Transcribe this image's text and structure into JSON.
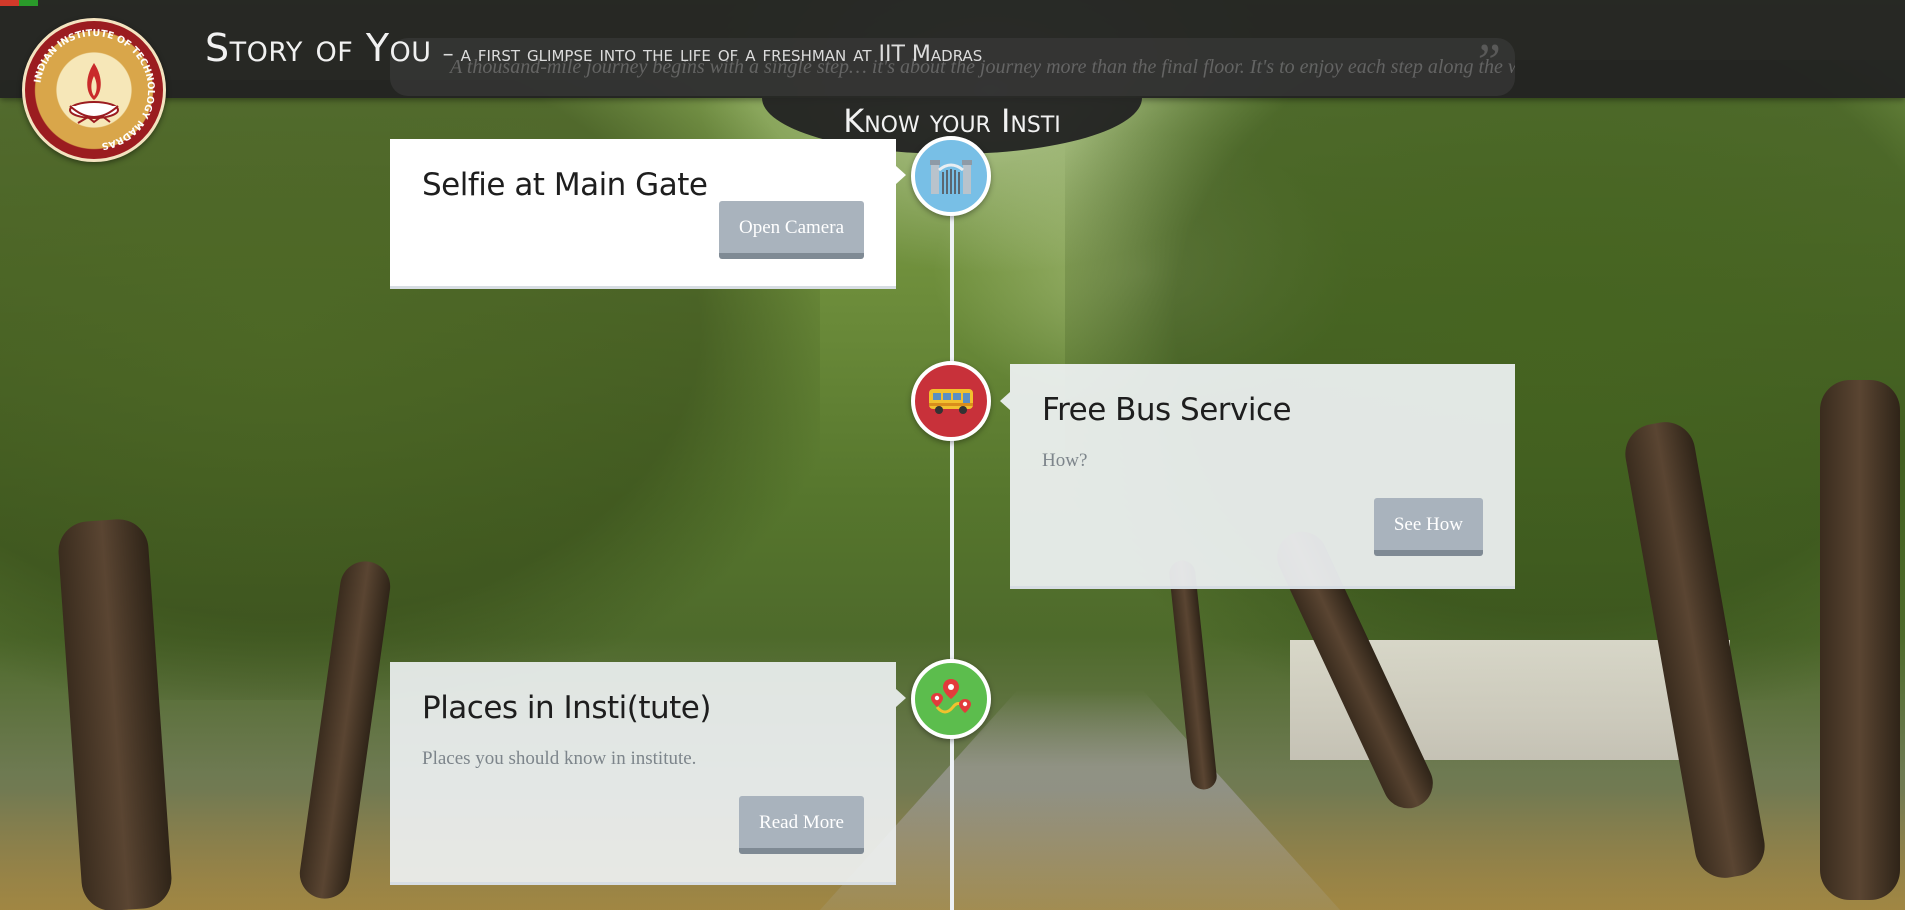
{
  "header": {
    "title": "Story of You",
    "subtitle": "– a first glimpse into the life of a freshman at IIT Madras",
    "quote": "A thousand-mile journey begins with a single step… it's about the journey more than the final floor. It's to enjoy each step along the way",
    "logo_text": "INDIAN INSTITUTE OF TECHNOLOGY MADRAS"
  },
  "section_tab": {
    "label": "Know your Insti"
  },
  "timeline": {
    "items": [
      {
        "title": "Selfie at Main Gate",
        "description": "",
        "button_label": "Open Camera",
        "icon": "gate-icon",
        "icon_color": "#78bfe6"
      },
      {
        "title": "Free Bus Service",
        "description": "How?",
        "button_label": "See How",
        "icon": "bus-icon",
        "icon_color": "#c8313a"
      },
      {
        "title": "Places in Insti(tute)",
        "description": "Places you should know in institute.",
        "button_label": "Read More",
        "icon": "map-route-icon",
        "icon_color": "#5cbd4d"
      }
    ]
  },
  "colors": {
    "header_bg": "#222222",
    "button_bg": "#a9b3bd",
    "timeline_line": "#eef2f6"
  }
}
